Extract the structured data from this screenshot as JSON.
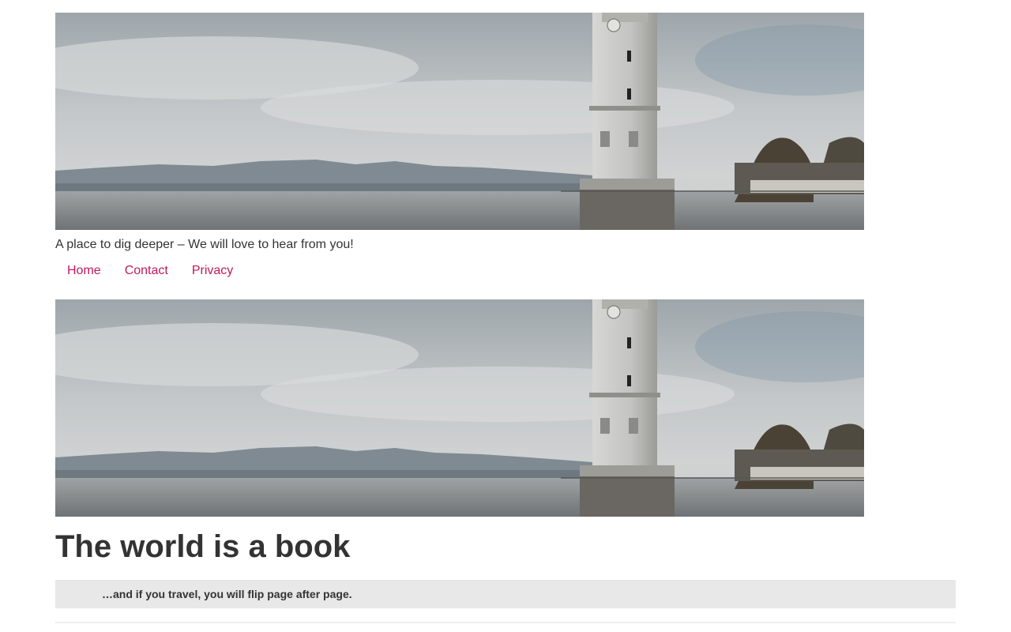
{
  "header": {
    "banner_image": "lighthouse-lake-photo",
    "tagline": "A place to dig deeper – We will love to hear from you!"
  },
  "nav": {
    "items": [
      {
        "label": "Home"
      },
      {
        "label": "Contact"
      },
      {
        "label": "Privacy"
      }
    ],
    "link_color": "#c2185b"
  },
  "post": {
    "hero_image": "lighthouse-lake-photo",
    "title": "The world is a book",
    "subtitle": "…and if you travel, you will flip page after page."
  }
}
